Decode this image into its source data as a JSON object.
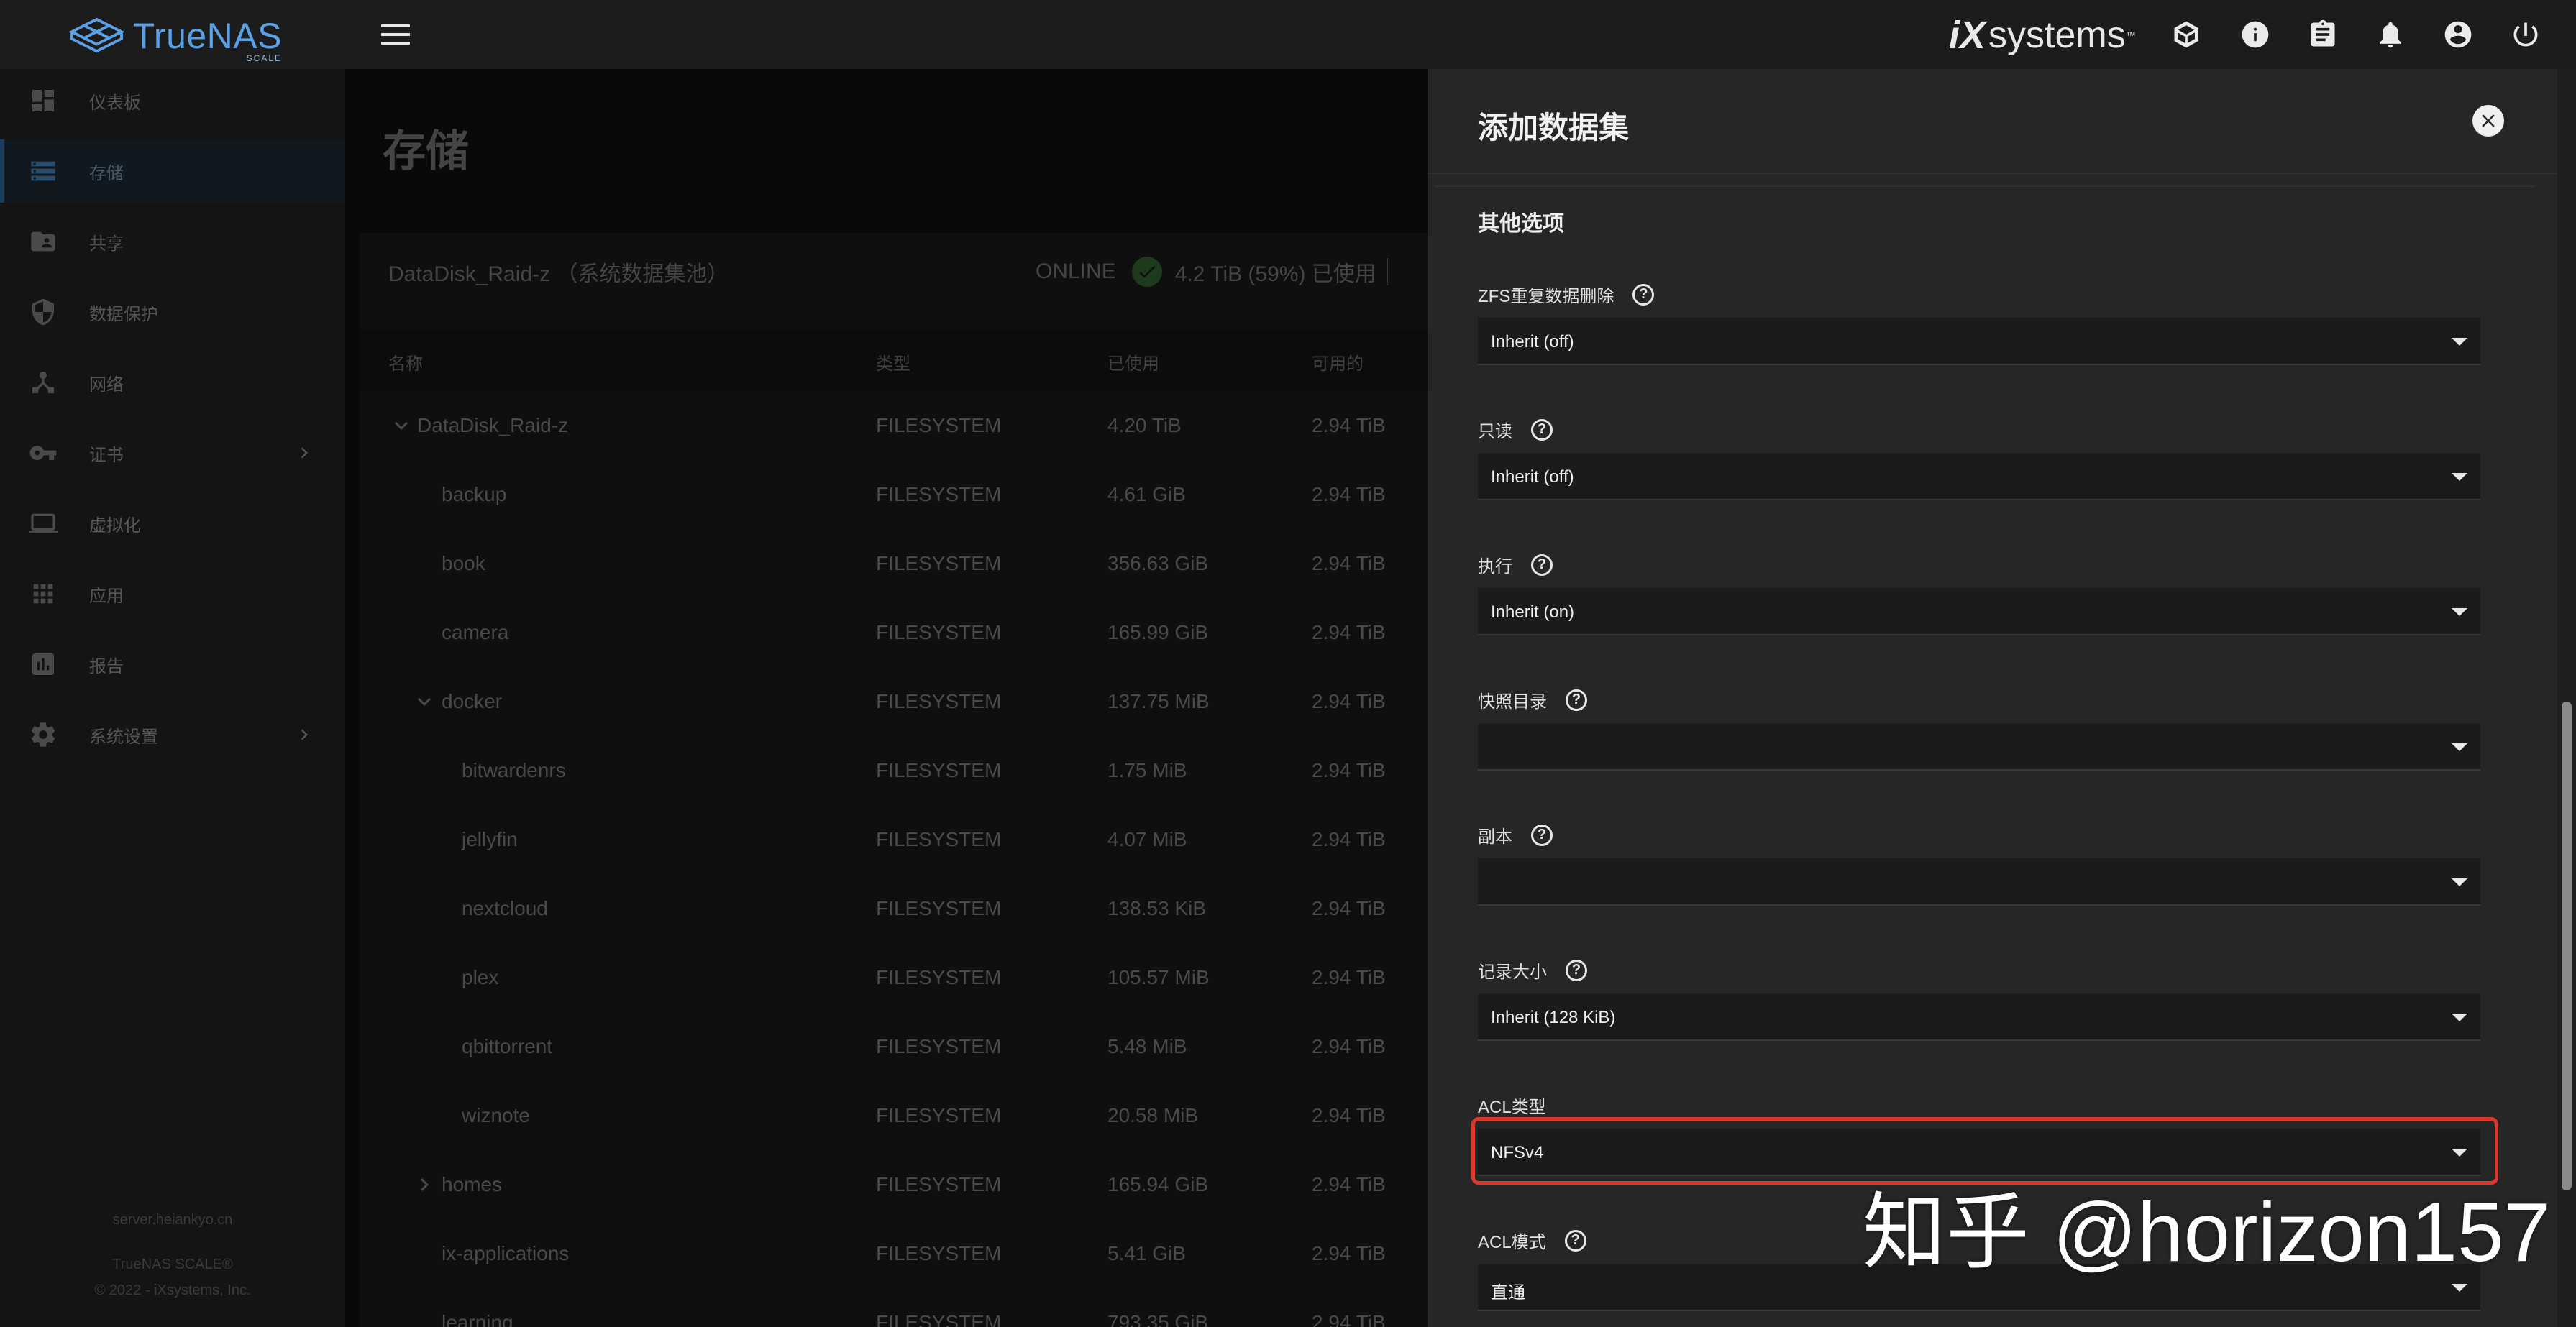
{
  "topbar": {
    "logo_text": "TrueNAS",
    "logo_sub": "SCALE",
    "brand_ix": "iX",
    "brand_systems": "systems",
    "brand_tm": "™"
  },
  "sidebar": {
    "items": [
      {
        "label": "仪表板",
        "icon": "dashboard-icon"
      },
      {
        "label": "存储",
        "icon": "storage-icon",
        "active": true
      },
      {
        "label": "共享",
        "icon": "share-icon"
      },
      {
        "label": "数据保护",
        "icon": "shield-icon"
      },
      {
        "label": "网络",
        "icon": "network-icon"
      },
      {
        "label": "证书",
        "icon": "key-icon",
        "has_children": true
      },
      {
        "label": "虚拟化",
        "icon": "laptop-icon"
      },
      {
        "label": "应用",
        "icon": "apps-icon"
      },
      {
        "label": "报告",
        "icon": "report-icon"
      },
      {
        "label": "系统设置",
        "icon": "gear-icon",
        "has_children": true
      }
    ],
    "footer_host": "server.heiankyo.cn",
    "footer_product": "TrueNAS SCALE®",
    "footer_copyright": "© 2022 - iXsystems, Inc."
  },
  "main": {
    "page_title": "存储",
    "pool": {
      "name": "DataDisk_Raid-z  （系统数据集池）",
      "status": "ONLINE",
      "usage": "4.2 TiB (59%) 已使用"
    },
    "columns": [
      "名称",
      "类型",
      "已使用",
      "可用的"
    ],
    "rows": [
      {
        "name": "DataDisk_Raid-z",
        "indent": 0,
        "caret": "down",
        "type": "FILESYSTEM",
        "used": "4.20 TiB",
        "avail": "2.94 TiB"
      },
      {
        "name": "backup",
        "indent": 1,
        "caret": "",
        "type": "FILESYSTEM",
        "used": "4.61 GiB",
        "avail": "2.94 TiB"
      },
      {
        "name": "book",
        "indent": 1,
        "caret": "",
        "type": "FILESYSTEM",
        "used": "356.63 GiB",
        "avail": "2.94 TiB"
      },
      {
        "name": "camera",
        "indent": 1,
        "caret": "",
        "type": "FILESYSTEM",
        "used": "165.99 GiB",
        "avail": "2.94 TiB"
      },
      {
        "name": "docker",
        "indent": 1,
        "caret": "down",
        "type": "FILESYSTEM",
        "used": "137.75 MiB",
        "avail": "2.94 TiB"
      },
      {
        "name": "bitwardenrs",
        "indent": 2,
        "caret": "",
        "type": "FILESYSTEM",
        "used": "1.75 MiB",
        "avail": "2.94 TiB"
      },
      {
        "name": "jellyfin",
        "indent": 2,
        "caret": "",
        "type": "FILESYSTEM",
        "used": "4.07 MiB",
        "avail": "2.94 TiB"
      },
      {
        "name": "nextcloud",
        "indent": 2,
        "caret": "",
        "type": "FILESYSTEM",
        "used": "138.53 KiB",
        "avail": "2.94 TiB"
      },
      {
        "name": "plex",
        "indent": 2,
        "caret": "",
        "type": "FILESYSTEM",
        "used": "105.57 MiB",
        "avail": "2.94 TiB"
      },
      {
        "name": "qbittorrent",
        "indent": 2,
        "caret": "",
        "type": "FILESYSTEM",
        "used": "5.48 MiB",
        "avail": "2.94 TiB"
      },
      {
        "name": "wiznote",
        "indent": 2,
        "caret": "",
        "type": "FILESYSTEM",
        "used": "20.58 MiB",
        "avail": "2.94 TiB"
      },
      {
        "name": "homes",
        "indent": 1,
        "caret": "right",
        "type": "FILESYSTEM",
        "used": "165.94 GiB",
        "avail": "2.94 TiB"
      },
      {
        "name": "ix-applications",
        "indent": 1,
        "caret": "",
        "type": "FILESYSTEM",
        "used": "5.41 GiB",
        "avail": "2.94 TiB"
      },
      {
        "name": "learning",
        "indent": 1,
        "caret": "",
        "type": "FILESYSTEM",
        "used": "793.35 GiB",
        "avail": "2.94 TiB"
      }
    ]
  },
  "panel": {
    "title": "添加数据集",
    "section_title": "其他选项",
    "fields": [
      {
        "label": "ZFS重复数据删除",
        "help": true,
        "value": "Inherit (off)"
      },
      {
        "label": "只读",
        "help": true,
        "value": "Inherit (off)"
      },
      {
        "label": "执行",
        "help": true,
        "value": "Inherit (on)"
      },
      {
        "label": "快照目录",
        "help": true,
        "value": ""
      },
      {
        "label": "副本",
        "help": true,
        "value": ""
      },
      {
        "label": "记录大小",
        "help": true,
        "value": "Inherit (128 KiB)"
      },
      {
        "label": "ACL类型",
        "help": false,
        "value": "NFSv4"
      },
      {
        "label": "ACL模式",
        "help": true,
        "value": "直通"
      }
    ]
  },
  "watermark": "知乎 @horizon157",
  "colors": {
    "accent_blue": "#5aa0e6",
    "highlight_red": "#e0362a",
    "panel_bg": "#262626"
  }
}
